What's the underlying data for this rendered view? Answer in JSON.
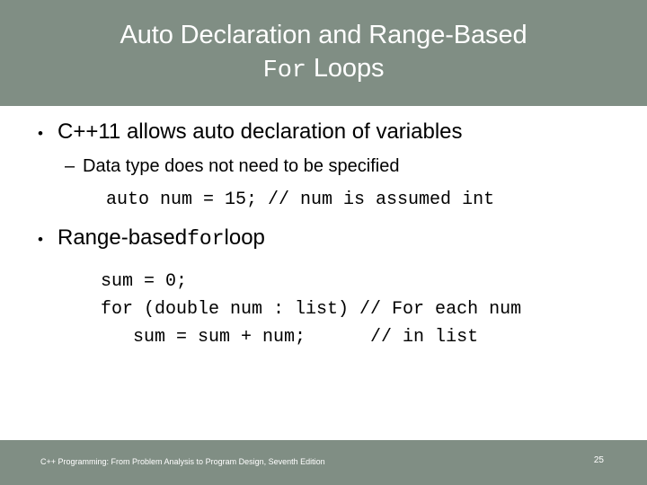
{
  "slide": {
    "background_color": "#ffffff",
    "accent_color": "#808e84",
    "text_color": "#000000",
    "banner_text_color": "#ffffff"
  },
  "title": {
    "line1": "Auto Declaration and Range-Based",
    "line2_mono": "For",
    "line2_rest": " Loops"
  },
  "content": {
    "bullet1": {
      "marker": "•",
      "text": "C++11 allows auto declaration of variables"
    },
    "subbullet1": {
      "marker": "–",
      "text": "Data type does not need to be specified"
    },
    "code1": "auto num = 15; // num is assumed int",
    "bullet2": {
      "marker": "•",
      "text_before": "Range-based ",
      "text_mono": "for",
      "text_after": " loop"
    },
    "code2": {
      "line1": "sum = 0;",
      "line2": "for (double num : list) // For each num",
      "line3": "   sum = sum + num;      // in list"
    }
  },
  "footer": {
    "attribution": "C++ Programming: From Problem Analysis to Program Design, Seventh Edition",
    "page_number": "25"
  }
}
